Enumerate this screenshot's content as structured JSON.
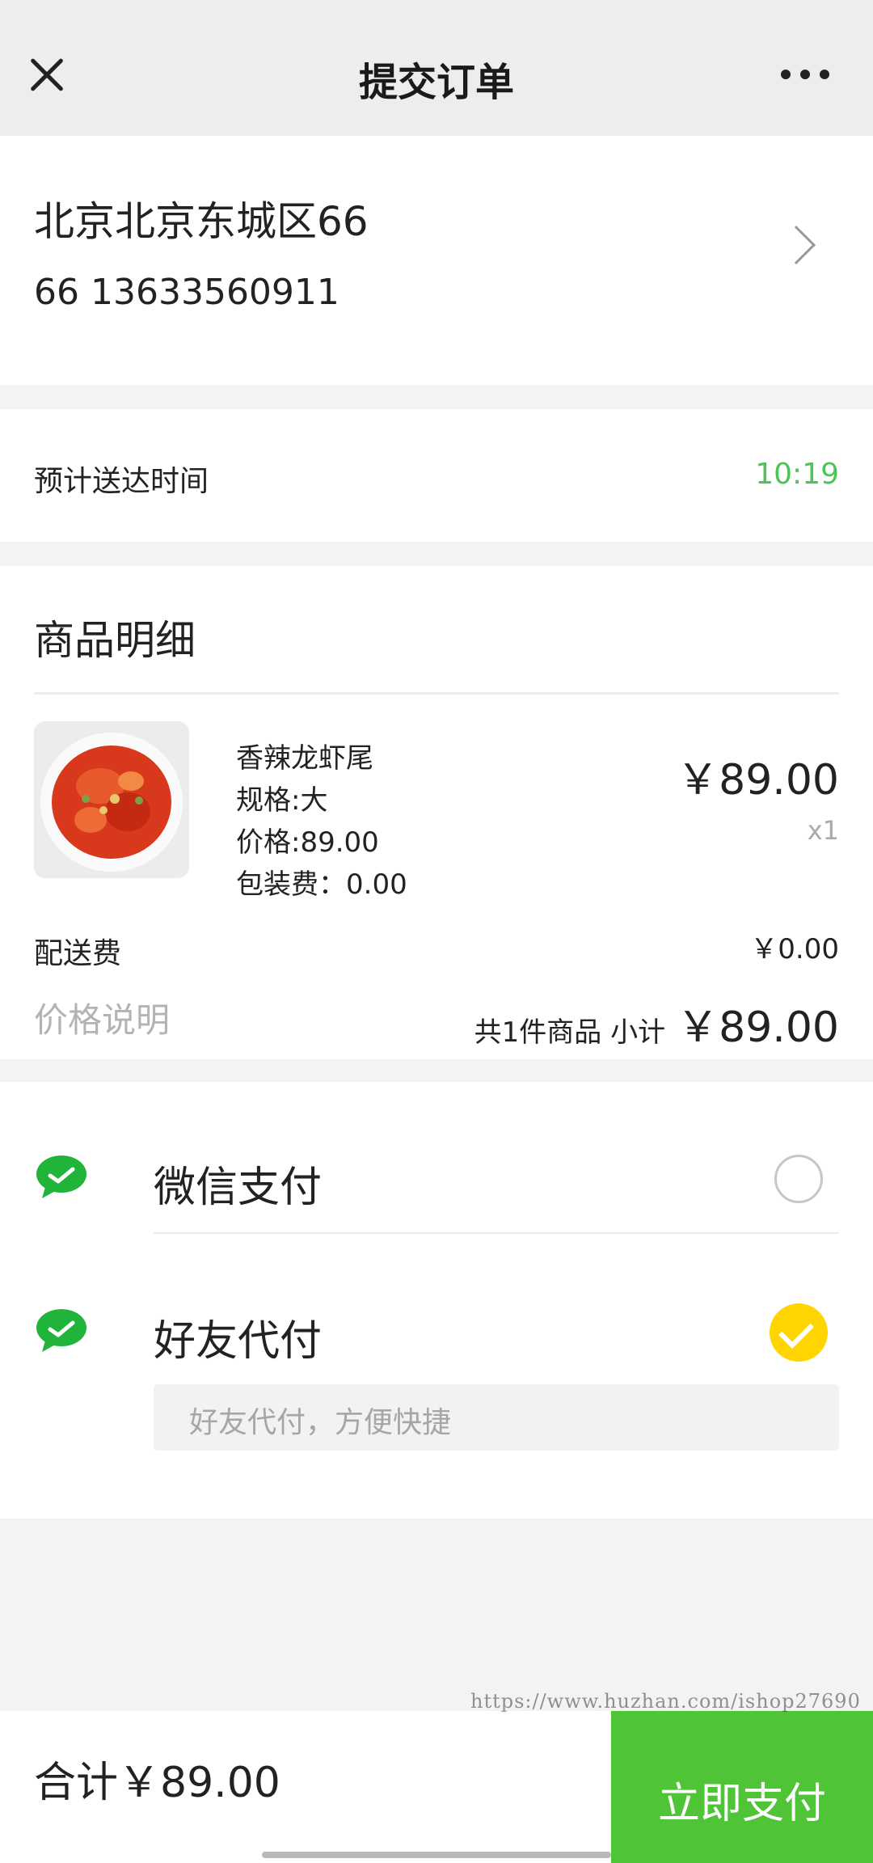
{
  "header": {
    "title": "提交订单"
  },
  "address": {
    "line1": "北京北京东城区66",
    "line2": "66 13633560911"
  },
  "delivery": {
    "label": "预计送达时间",
    "time": "10:19",
    "time_color": "#4fc25a"
  },
  "goods": {
    "title": "商品明细",
    "item": {
      "name": "香辣龙虾尾",
      "spec": "规格:大",
      "price": "价格:89.00",
      "packing": "包装费：0.00",
      "amount": "￥89.00",
      "qty": "x1"
    },
    "shipping_label": "配送费",
    "shipping_value": "￥0.00",
    "price_note": "价格说明",
    "count_text": "共1件商品 小计",
    "subtotal": "￥89.00"
  },
  "payment": {
    "options": [
      {
        "name": "微信支付",
        "selected": false
      },
      {
        "name": "好友代付",
        "selected": true
      }
    ],
    "friend_hint": "好友代付，方便快捷"
  },
  "footer": {
    "total": "合计￥89.00",
    "pay_button": "立即支付",
    "button_color": "#4fc437"
  },
  "watermark": "https://www.huzhan.com/ishop27690"
}
